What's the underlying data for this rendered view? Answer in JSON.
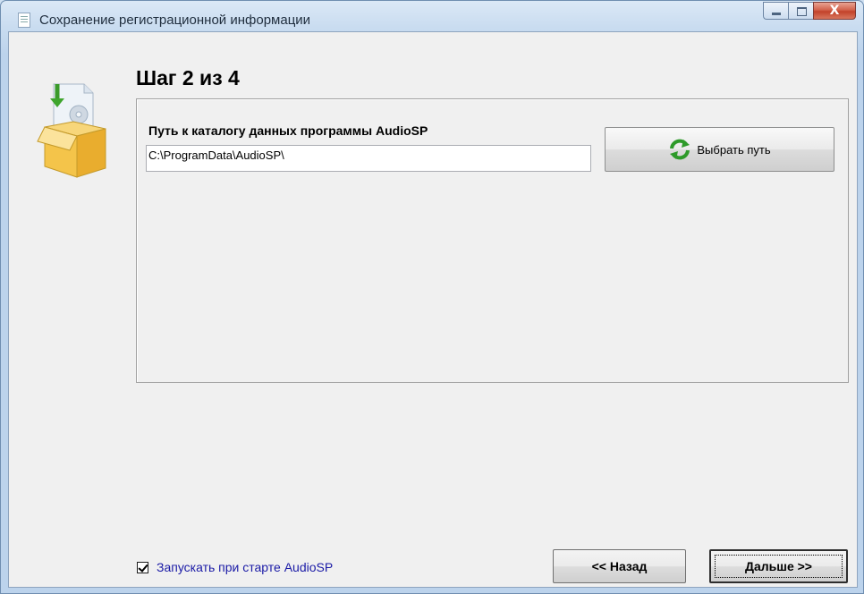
{
  "window": {
    "title": "Сохранение регистрационной информации",
    "close_glyph": "X"
  },
  "wizard": {
    "step_title": "Шаг 2 из 4",
    "path_label": "Путь к каталогу данных программы AudioSP",
    "path_value": "C:\\ProgramData\\AudioSP\\",
    "choose_button_label": "Выбрать путь",
    "autostart_label": "Запускать при старте AudioSP",
    "autostart_checked": true,
    "back_button_label": "<< Назад",
    "next_button_label": "Дальше >>"
  },
  "icons": {
    "window": "document-icon",
    "wizard": "package-install-icon",
    "choose": "refresh-icon"
  },
  "colors": {
    "checkbox_label": "#1a1aa6",
    "close_button": "#c2422a",
    "client_bg": "#f0f0f0"
  }
}
